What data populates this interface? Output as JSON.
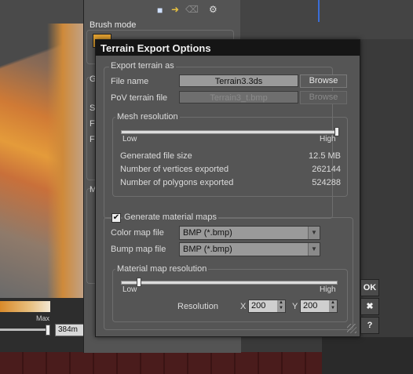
{
  "background": {
    "brush_mode_label": "Brush mode",
    "max_label": "Max",
    "height_value": "384m",
    "panel_stubs": [
      "G",
      "S",
      "F",
      "F",
      "M"
    ]
  },
  "dialog": {
    "title": "Terrain Export Options",
    "export_group": {
      "label": "Export terrain as",
      "file_name_label": "File name",
      "file_name_value": "Terrain3.3ds",
      "browse_label": "Browse",
      "pov_label": "PoV terrain file",
      "pov_value": "Terrain3_t.bmp",
      "pov_browse_label": "Browse"
    },
    "mesh_group": {
      "label": "Mesh resolution",
      "low_label": "Low",
      "high_label": "High",
      "slider_fraction": 1.0,
      "stats": [
        {
          "label": "Generated file size",
          "value": "12.5 MB"
        },
        {
          "label": "Number of vertices exported",
          "value": "262144"
        },
        {
          "label": "Number of polygons exported",
          "value": "524288"
        }
      ]
    },
    "material_group": {
      "generate_label": "Generate material maps",
      "generate_checked": true,
      "color_map_label": "Color map file",
      "color_map_value": "BMP (*.bmp)",
      "bump_map_label": "Bump map file",
      "bump_map_value": "BMP (*.bmp)",
      "resolution_group": {
        "label": "Material map resolution",
        "low_label": "Low",
        "high_label": "High",
        "slider_fraction": 0.08,
        "resolution_label": "Resolution",
        "x_label": "X",
        "x_value": "200",
        "y_label": "Y",
        "y_value": "200"
      }
    },
    "side_buttons": {
      "ok_label": "OK",
      "close_label": "✖",
      "help_label": "?"
    }
  }
}
